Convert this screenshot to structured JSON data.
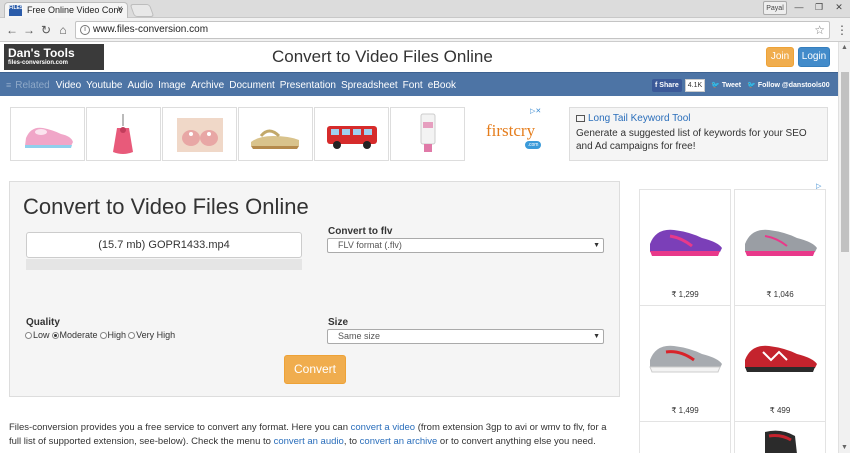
{
  "browser": {
    "tab_title": "Free Online Video Conv",
    "tab_favicon_text": "FILES",
    "tab_close": "×",
    "profile_label": "Payal",
    "minimize": "—",
    "maximize": "❐",
    "close": "✕",
    "url": "www.files-conversion.com",
    "back": "←",
    "forward": "→",
    "reload": "↻",
    "home": "⌂",
    "star": "☆",
    "menu": "⋮"
  },
  "header": {
    "logo_title": "Dan's Tools",
    "logo_sub": "files-conversion.com",
    "title": "Convert to Video Files Online",
    "join": "Join",
    "login": "Login"
  },
  "nav": {
    "related_icon": "≡",
    "related": "Related",
    "links": [
      "Video",
      "Youtube",
      "Audio",
      "Image",
      "Archive",
      "Document",
      "Presentation",
      "Spreadsheet",
      "Font",
      "eBook"
    ],
    "fb_share": "f Share",
    "fb_count": "4.1K",
    "tweet": "Tweet",
    "follow": "Follow @danstools00"
  },
  "ad_row": {
    "brand": "firstcry",
    "brand_suffix": ".com"
  },
  "tool_box": {
    "link": "Long Tail Keyword Tool",
    "description": "Generate a suggested list of keywords for your SEO and Ad campaigns for free!"
  },
  "converter": {
    "title": "Convert to Video Files Online",
    "file": "(15.7 mb) GOPR1433.mp4",
    "convert_to_label": "Convert to flv",
    "format_value": "FLV format (.flv)",
    "quality_label": "Quality",
    "quality_options": [
      "Low",
      "Moderate",
      "High",
      "Very High"
    ],
    "quality_selected": 1,
    "size_label": "Size",
    "size_value": "Same size",
    "convert_button": "Convert"
  },
  "description": {
    "t1": "Files-conversion provides you a free service to convert any format. Here you can ",
    "l1": "convert a video",
    "t2": " (from extension 3gp to avi or wmv to flv, for a full list of supported extension, see-below). Check the menu to ",
    "l2": "convert an audio",
    "t3": ", to ",
    "l3": "convert an archive",
    "t4": " or to convert anything else you need."
  },
  "side_ad": {
    "products": [
      {
        "price": "₹ 1,299",
        "color": "#7b3fb8",
        "accent": "#e8398a"
      },
      {
        "price": "₹ 1,046",
        "color": "#9a9ea4",
        "accent": "#e8398a"
      },
      {
        "price": "₹ 1,499",
        "color": "#a7abb0",
        "accent": "#d8232a"
      },
      {
        "price": "₹ 499",
        "color": "#c4232d",
        "accent": "#2b2b2b"
      }
    ]
  },
  "colors": {
    "nav_bg": "#4d74a5",
    "accent_orange": "#f0ad4e",
    "accent_blue": "#428bca",
    "link": "#2a6ebb"
  }
}
